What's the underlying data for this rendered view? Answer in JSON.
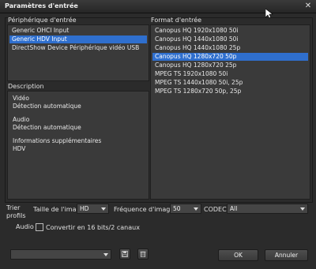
{
  "window": {
    "title": "Paramètres d'entrée",
    "close_glyph": "✕"
  },
  "device": {
    "header": "Périphérique d'entrée",
    "items": [
      {
        "label": "Generic OHCI Input",
        "selected": false
      },
      {
        "label": "Generic HDV Input",
        "selected": true
      },
      {
        "label": "DirectShow Device Périphérique vidéo USB",
        "selected": false
      }
    ]
  },
  "format": {
    "header": "Format d'entrée",
    "items": [
      {
        "label": "Canopus HQ  1920x1080  50i",
        "selected": false
      },
      {
        "label": "Canopus HQ  1440x1080  50i",
        "selected": false
      },
      {
        "label": "Canopus HQ  1440x1080  25p",
        "selected": false
      },
      {
        "label": "Canopus HQ  1280x720  50p",
        "selected": true
      },
      {
        "label": "Canopus HQ  1280x720  25p",
        "selected": false
      },
      {
        "label": "MPEG TS  1920x1080  50i",
        "selected": false
      },
      {
        "label": "MPEG TS  1440x1080  50i, 25p",
        "selected": false
      },
      {
        "label": "MPEG TS  1280x720  50p, 25p",
        "selected": false
      }
    ]
  },
  "description": {
    "header": "Description",
    "lines": [
      "Vidéo",
      "Détection automatique",
      "",
      "Audio",
      "Détection automatique",
      "",
      "Informations supplémentaires",
      "HDV"
    ]
  },
  "filters": {
    "trier": "Trier",
    "profils": "profils",
    "taille_label": "Taille de l'image",
    "taille_value": "HD",
    "frequence_label": "Fréquence d'images",
    "frequence_value": "50",
    "codec_label": "CODEC",
    "codec_value": "All"
  },
  "audio": {
    "label": "Audio",
    "convert_label": "Convertir en 16 bits/2 canaux",
    "checked": false
  },
  "footer": {
    "preset_value": "",
    "ok_label": "OK",
    "cancel_label": "Annuler"
  },
  "icons": {
    "close": "close-icon",
    "save_preset": "save-preset-icon",
    "delete_preset": "delete-preset-icon"
  }
}
